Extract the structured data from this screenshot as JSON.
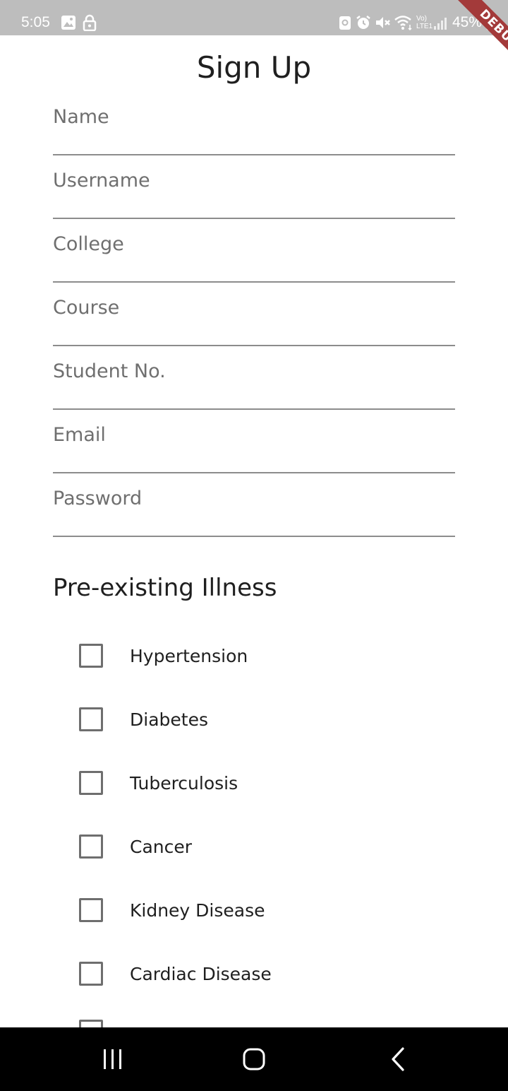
{
  "status_bar": {
    "time": "5:05",
    "battery": "45%",
    "network_label": "Vo) LTE1",
    "icons": [
      "gallery-icon",
      "lock-icon",
      "nfc-icon",
      "alarm-icon",
      "mute-icon",
      "wifi-icon",
      "signal-icon",
      "battery-icon"
    ]
  },
  "debug_banner": {
    "label": "DEBUG"
  },
  "page": {
    "title": "Sign Up"
  },
  "fields": [
    {
      "placeholder": "Name",
      "value": ""
    },
    {
      "placeholder": "Username",
      "value": ""
    },
    {
      "placeholder": "College",
      "value": ""
    },
    {
      "placeholder": "Course",
      "value": ""
    },
    {
      "placeholder": "Student No.",
      "value": ""
    },
    {
      "placeholder": "Email",
      "value": ""
    },
    {
      "placeholder": "Password",
      "value": ""
    }
  ],
  "illness_section": {
    "heading": "Pre-existing Illness",
    "options": [
      {
        "label": "Hypertension",
        "checked": false
      },
      {
        "label": "Diabetes",
        "checked": false
      },
      {
        "label": "Tuberculosis",
        "checked": false
      },
      {
        "label": "Cancer",
        "checked": false
      },
      {
        "label": "Kidney Disease",
        "checked": false
      },
      {
        "label": "Cardiac Disease",
        "checked": false
      }
    ]
  },
  "nav_bar": {
    "icons": [
      "recent-apps-icon",
      "home-icon",
      "back-icon"
    ]
  }
}
